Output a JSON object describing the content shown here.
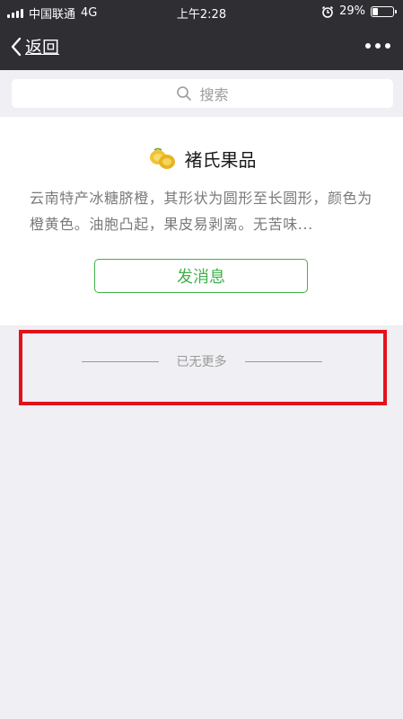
{
  "status_bar": {
    "carrier": "中国联通",
    "network": "4G",
    "time": "上午2:28",
    "battery": "29%",
    "battery_level": 0.29
  },
  "nav": {
    "back_label": "返回"
  },
  "search": {
    "placeholder": "搜索"
  },
  "profile": {
    "name": "褚氏果品",
    "description": "云南特产冰糖脐橙，其形状为圆形至长圆形，颜色为橙黄色。油胞凸起，果皮易剥离。无苦味...",
    "message_button": "发消息"
  },
  "footer": {
    "no_more_text": "已无更多"
  },
  "colors": {
    "header_bg": "#2e2e33",
    "accent_green": "#3fb24a",
    "highlight_red": "#e3121a",
    "page_bg": "#efeff4"
  }
}
